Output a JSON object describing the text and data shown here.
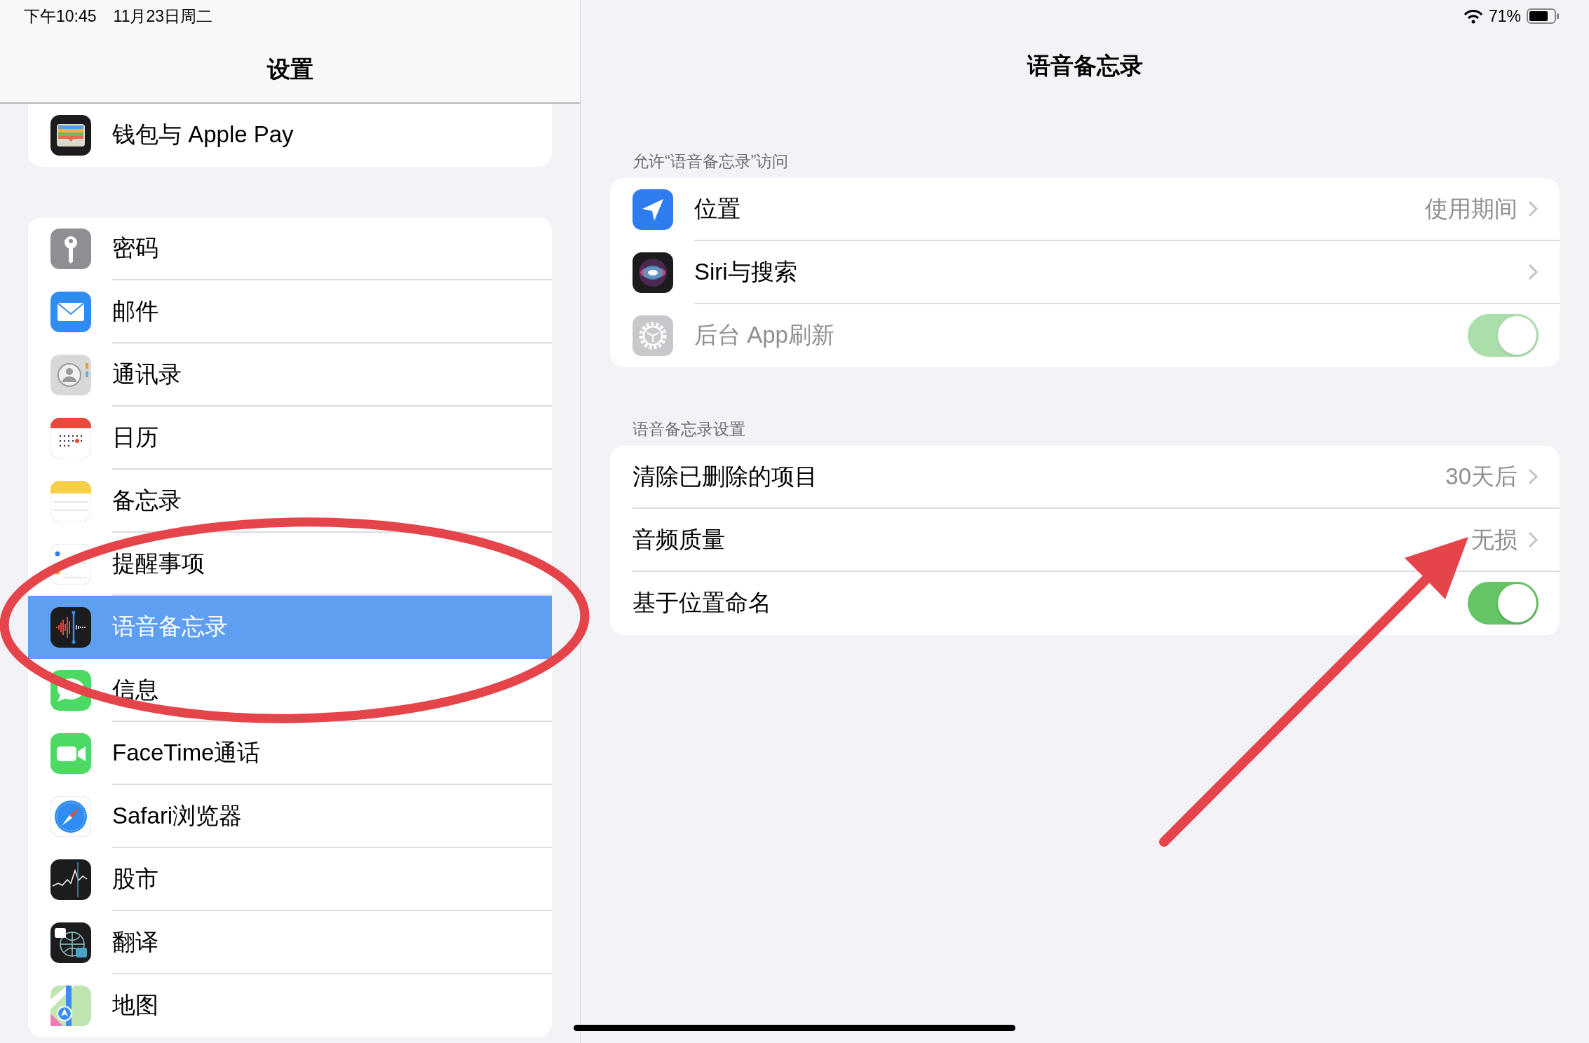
{
  "status_bar": {
    "time": "下午10:45",
    "date": "11月23日周二",
    "battery": "71%"
  },
  "sidebar": {
    "title": "设置",
    "groups": [
      {
        "items": [
          {
            "label": "钱包与 Apple Pay",
            "selected": false
          }
        ]
      },
      {
        "items": [
          {
            "label": "密码",
            "selected": false
          },
          {
            "label": "邮件",
            "selected": false
          },
          {
            "label": "通讯录",
            "selected": false
          },
          {
            "label": "日历",
            "selected": false
          },
          {
            "label": "备忘录",
            "selected": false
          },
          {
            "label": "提醒事项",
            "selected": false
          },
          {
            "label": "语音备忘录",
            "selected": true
          },
          {
            "label": "信息",
            "selected": false
          },
          {
            "label": "FaceTime通话",
            "selected": false
          },
          {
            "label": "Safari浏览器",
            "selected": false
          },
          {
            "label": "股市",
            "selected": false
          },
          {
            "label": "翻译",
            "selected": false
          },
          {
            "label": "地图",
            "selected": false
          }
        ]
      }
    ]
  },
  "detail": {
    "title": "语音备忘录",
    "sections": [
      {
        "header": "允许“语音备忘录”访问",
        "rows": [
          {
            "kind": "link",
            "label": "位置",
            "value": "使用期间"
          },
          {
            "kind": "link",
            "label": "Siri与搜索"
          },
          {
            "kind": "toggle",
            "label": "后台 App刷新",
            "on": true,
            "disabled": true
          }
        ]
      },
      {
        "header": "语音备忘录设置",
        "rows": [
          {
            "kind": "link",
            "label": "清除已删除的项目",
            "value": "30天后"
          },
          {
            "kind": "link",
            "label": "音频质量",
            "value": "无损"
          },
          {
            "kind": "toggle",
            "label": "基于位置命名",
            "on": true,
            "disabled": false
          }
        ]
      }
    ]
  },
  "annotations": [
    {
      "kind": "ellipse"
    },
    {
      "kind": "arrow"
    }
  ]
}
